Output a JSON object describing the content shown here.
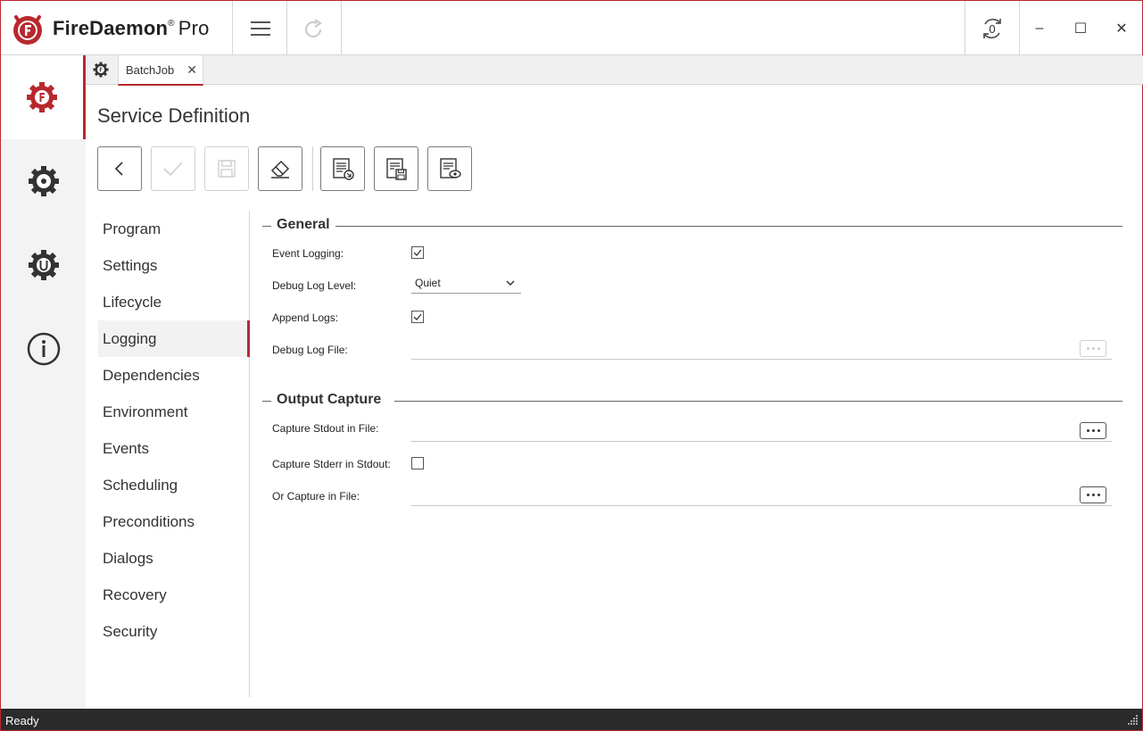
{
  "app": {
    "brand": "FireDaemon",
    "brand_mark": "®",
    "edition": "Pro"
  },
  "titlebar": {
    "menu_icon": "hamburger-icon",
    "redo_icon": "redo-icon",
    "refresh_icon": "refresh-counter-icon",
    "refresh_count": "0",
    "minimize": "–",
    "maximize": "☐",
    "close": "✕"
  },
  "rail": [
    {
      "name": "services",
      "icon": "firedaemon-gear-icon",
      "active": true
    },
    {
      "name": "settings",
      "icon": "gear-icon",
      "active": false
    },
    {
      "name": "updates",
      "icon": "update-gear-icon",
      "active": false
    },
    {
      "name": "about",
      "icon": "info-icon",
      "active": false
    }
  ],
  "tabs": [
    {
      "label": "BatchJob",
      "close": "✕"
    }
  ],
  "page": {
    "title": "Service Definition"
  },
  "toolbar": [
    {
      "name": "back",
      "icon": "chevron-left-icon",
      "enabled": true
    },
    {
      "name": "apply",
      "icon": "checkmark-icon",
      "enabled": false
    },
    {
      "name": "save",
      "icon": "save-icon",
      "enabled": false
    },
    {
      "name": "clear",
      "icon": "eraser-icon",
      "enabled": true
    },
    {
      "name": "export",
      "icon": "document-export-icon",
      "enabled": true
    },
    {
      "name": "save-as",
      "icon": "document-save-icon",
      "enabled": true
    },
    {
      "name": "view",
      "icon": "document-view-icon",
      "enabled": true
    }
  ],
  "sections": [
    {
      "label": "Program",
      "active": false
    },
    {
      "label": "Settings",
      "active": false
    },
    {
      "label": "Lifecycle",
      "active": false
    },
    {
      "label": "Logging",
      "active": true
    },
    {
      "label": "Dependencies",
      "active": false
    },
    {
      "label": "Environment",
      "active": false
    },
    {
      "label": "Events",
      "active": false
    },
    {
      "label": "Scheduling",
      "active": false
    },
    {
      "label": "Preconditions",
      "active": false
    },
    {
      "label": "Dialogs",
      "active": false
    },
    {
      "label": "Recovery",
      "active": false
    },
    {
      "label": "Security",
      "active": false
    }
  ],
  "general": {
    "title": "General",
    "event_logging": {
      "label": "Event Logging:",
      "checked": true
    },
    "debug_log_level": {
      "label": "Debug Log Level:",
      "value": "Quiet"
    },
    "append_logs": {
      "label": "Append Logs:",
      "checked": true
    },
    "debug_log_file": {
      "label": "Debug Log File:",
      "value": ""
    }
  },
  "output_capture": {
    "title": "Output Capture",
    "stdout_file": {
      "label": "Capture Stdout in File:",
      "value": ""
    },
    "stderr_in_stdout": {
      "label": "Capture Stderr in Stdout:",
      "checked": false
    },
    "or_capture_file": {
      "label": "Or Capture in File:",
      "value": ""
    }
  },
  "status": {
    "text": "Ready"
  },
  "colors": {
    "accent": "#b8282e",
    "status_bg": "#2b2b2b"
  }
}
